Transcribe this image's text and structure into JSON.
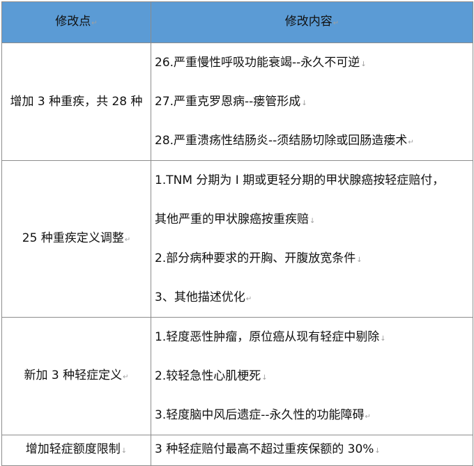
{
  "header": {
    "col1": "修改点",
    "col2": "修改内容"
  },
  "rows": [
    {
      "point": "增加 3 种重疾，共 28 种",
      "content": [
        "26.严重慢性呼吸功能衰竭--永久不可逆",
        "27.严重克罗恩病--瘘管形成",
        "28.严重溃疡性结肠炎--须结肠切除或回肠造瘘术"
      ]
    },
    {
      "point": "25 种重疾定义调整",
      "content": [
        "1.TNM 分期为 I 期或更轻分期的甲状腺癌按轻症赔付，",
        "其他严重的甲状腺癌按重疾赔",
        "2.部分病种要求的开胸、开腹放宽条件",
        "3、其他描述优化"
      ]
    },
    {
      "point": "新加 3 种轻症定义",
      "content": [
        "1.轻度恶性肿瘤，原位癌从现有轻症中剔除",
        "2.较轻急性心肌梗死",
        "3.轻度脑中风后遗症--永久性的功能障碍"
      ]
    },
    {
      "point": "增加轻症额度限制",
      "content": [
        "3 种轻症赔付最高不超过重疾保额的 30%"
      ]
    }
  ]
}
